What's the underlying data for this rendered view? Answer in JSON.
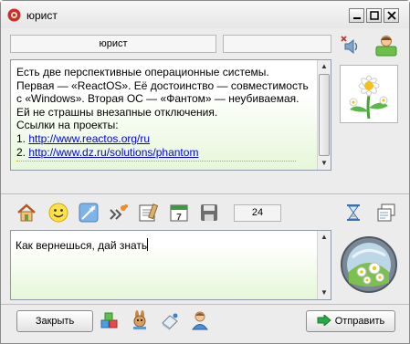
{
  "window": {
    "title": "юрист"
  },
  "header": {
    "contact_field": "юрист",
    "status_field": ""
  },
  "chat": {
    "lines": [
      "Есть две перспективные операционные системы.",
      "Первая — «ReactOS». Её достоинство — совместимость",
      "с «Windows». Вторая ОС — «Фантом» — неубиваемая.",
      "Ей не страшны внезапные отключения.",
      "Ссылки на проекты:"
    ],
    "links": [
      {
        "num": "1. ",
        "url": "http://www.reactos.org/ru"
      },
      {
        "num": "2. ",
        "url": "http://www.dz.ru/solutions/phantom"
      }
    ]
  },
  "toolbar": {
    "counter": "24"
  },
  "input": {
    "value": "Как вернешься, дай знать"
  },
  "buttons": {
    "close_label": "Закрыть",
    "send_label": "Отправить"
  },
  "colors": {
    "link": "#0000ee",
    "accent_green": "#2aa84a",
    "input_gradient": "#e6f7d9"
  },
  "icons": {
    "header": [
      "speaker-mute-icon",
      "user-profile-icon"
    ],
    "toolbar": [
      "home-icon",
      "smiley-icon",
      "sparkle-icon",
      "forward-icon",
      "notes-icon",
      "calendar-icon",
      "save-icon",
      "hourglass-icon",
      "history-icon"
    ],
    "bottom": [
      "cubes-icon",
      "bunny-icon",
      "eraser-icon",
      "contact-icon"
    ]
  }
}
